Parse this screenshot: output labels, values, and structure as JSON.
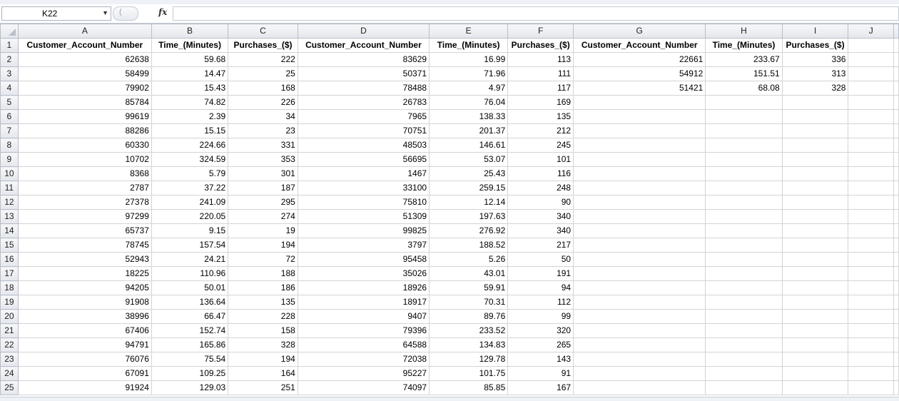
{
  "namebox": {
    "value": "K22"
  },
  "formula": {
    "fx": "fx",
    "value": ""
  },
  "columns": [
    "A",
    "B",
    "C",
    "D",
    "E",
    "F",
    "G",
    "H",
    "I",
    "J"
  ],
  "headers": [
    "Customer_Account_Number",
    "Time_(Minutes)",
    "Purchases_($)",
    "Customer_Account_Number",
    "Time_(Minutes)",
    "Purchases_($)",
    "Customer_Account_Number",
    "Time_(Minutes)",
    "Purchases_($)"
  ],
  "rows": [
    [
      "62638",
      "59.68",
      "222",
      "83629",
      "16.99",
      "113",
      "22661",
      "233.67",
      "336"
    ],
    [
      "58499",
      "14.47",
      "25",
      "50371",
      "71.96",
      "111",
      "54912",
      "151.51",
      "313"
    ],
    [
      "79902",
      "15.43",
      "168",
      "78488",
      "4.97",
      "117",
      "51421",
      "68.08",
      "328"
    ],
    [
      "85784",
      "74.82",
      "226",
      "26783",
      "76.04",
      "169",
      "",
      "",
      ""
    ],
    [
      "99619",
      "2.39",
      "34",
      "7965",
      "138.33",
      "135",
      "",
      "",
      ""
    ],
    [
      "88286",
      "15.15",
      "23",
      "70751",
      "201.37",
      "212",
      "",
      "",
      ""
    ],
    [
      "60330",
      "224.66",
      "331",
      "48503",
      "146.61",
      "245",
      "",
      "",
      ""
    ],
    [
      "10702",
      "324.59",
      "353",
      "56695",
      "53.07",
      "101",
      "",
      "",
      ""
    ],
    [
      "8368",
      "5.79",
      "301",
      "1467",
      "25.43",
      "116",
      "",
      "",
      ""
    ],
    [
      "2787",
      "37.22",
      "187",
      "33100",
      "259.15",
      "248",
      "",
      "",
      ""
    ],
    [
      "27378",
      "241.09",
      "295",
      "75810",
      "12.14",
      "90",
      "",
      "",
      ""
    ],
    [
      "97299",
      "220.05",
      "274",
      "51309",
      "197.63",
      "340",
      "",
      "",
      ""
    ],
    [
      "65737",
      "9.15",
      "19",
      "99825",
      "276.92",
      "340",
      "",
      "",
      ""
    ],
    [
      "78745",
      "157.54",
      "194",
      "3797",
      "188.52",
      "217",
      "",
      "",
      ""
    ],
    [
      "52943",
      "24.21",
      "72",
      "95458",
      "5.26",
      "50",
      "",
      "",
      ""
    ],
    [
      "18225",
      "110.96",
      "188",
      "35026",
      "43.01",
      "191",
      "",
      "",
      ""
    ],
    [
      "94205",
      "50.01",
      "186",
      "18926",
      "59.91",
      "94",
      "",
      "",
      ""
    ],
    [
      "91908",
      "136.64",
      "135",
      "18917",
      "70.31",
      "112",
      "",
      "",
      ""
    ],
    [
      "38996",
      "66.47",
      "228",
      "9407",
      "89.76",
      "99",
      "",
      "",
      ""
    ],
    [
      "67406",
      "152.74",
      "158",
      "79396",
      "233.52",
      "320",
      "",
      "",
      ""
    ],
    [
      "94791",
      "165.86",
      "328",
      "64588",
      "134.83",
      "265",
      "",
      "",
      ""
    ],
    [
      "76076",
      "75.54",
      "194",
      "72038",
      "129.78",
      "143",
      "",
      "",
      ""
    ],
    [
      "67091",
      "109.25",
      "164",
      "95227",
      "101.75",
      "91",
      "",
      "",
      ""
    ],
    [
      "91924",
      "129.03",
      "251",
      "74097",
      "85.85",
      "167",
      "",
      "",
      ""
    ]
  ]
}
